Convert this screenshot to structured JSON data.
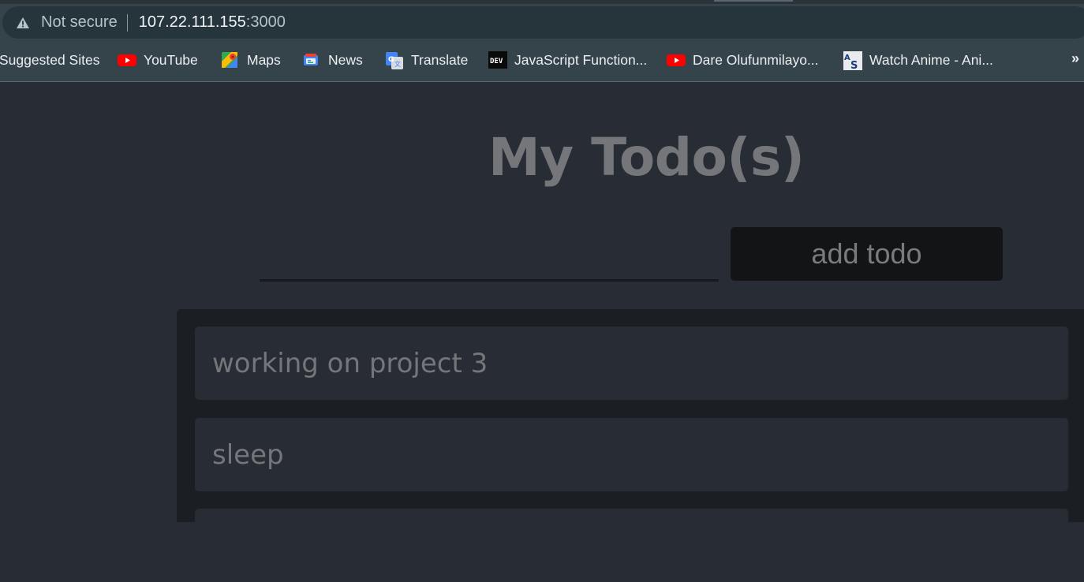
{
  "browser": {
    "security_label": "Not secure",
    "url_host": "107.22.111.155",
    "url_port": ":3000"
  },
  "bookmarks": [
    {
      "label": "Suggested Sites",
      "icon": "suggested-sites-icon"
    },
    {
      "label": "YouTube",
      "icon": "youtube-icon"
    },
    {
      "label": "Maps",
      "icon": "maps-icon"
    },
    {
      "label": "News",
      "icon": "news-icon"
    },
    {
      "label": "Translate",
      "icon": "translate-icon"
    },
    {
      "label": "JavaScript Function...",
      "icon": "dev-icon"
    },
    {
      "label": "Dare Olufunmilayo...",
      "icon": "youtube-icon"
    },
    {
      "label": "Watch Anime - Ani...",
      "icon": "anime-site-icon"
    }
  ],
  "bookmarks_overflow": "»",
  "app": {
    "title": "My Todo(s)",
    "input_value": "",
    "add_button_label": "add todo",
    "todos": [
      {
        "text": "working on project 3"
      },
      {
        "text": "sleep"
      }
    ]
  },
  "colors": {
    "page_bg": "#282c34",
    "list_bg": "#1b1e23",
    "button_bg": "#121416",
    "muted_text": "#75767a",
    "chrome_bg": "#35434a"
  }
}
